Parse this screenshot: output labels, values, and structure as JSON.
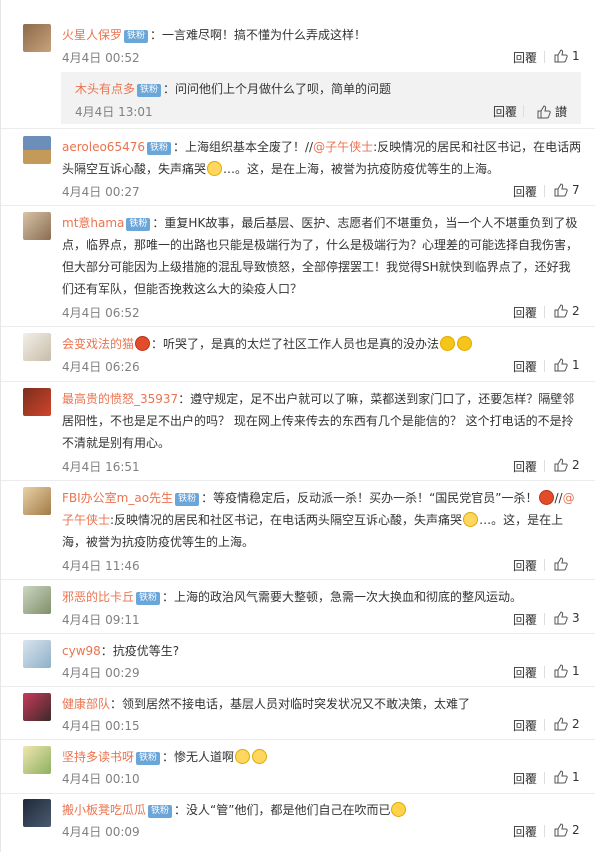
{
  "ui": {
    "reply_label": "回覆",
    "like_placeholder": "讃",
    "badge_label": "铁粉"
  },
  "comments": [
    {
      "user": "火星人保罗",
      "badge": true,
      "text": "：一言难尽啊！搞不懂为什么弄成这样！",
      "time": "4月4日 00:52",
      "likes": "1",
      "sub": {
        "user": "木头有点多",
        "badge": true,
        "text": "：问问他们上个月做什么了呗，简单的问题",
        "time": "4月4日 13:01"
      }
    },
    {
      "user": "aeroleo65476",
      "badge": true,
      "text_a": "：上海组织基本全废了！//",
      "mention": "@子午侠士",
      "text_b": ":反映情况的居民和社区书记，在电话两头隔空互诉心酸，失声痛哭",
      "text_c": "…。这，是在上海，被誉为抗疫防疫优等生的上海。",
      "time": "4月4日 00:27",
      "likes": "7"
    },
    {
      "user": "mt意hama",
      "badge": true,
      "text": "：重复HK故事，最后基层、医护、志愿者们不堪重负，当一个人不堪重负到了极点，临界点，那唯一的出路也只能是极端行为了，什么是极端行为？心理差的可能选择自我伤害，但大部分可能因为上级措施的混乱导致愤怒，全部停摆罢工！我觉得SH就快到临界点了，还好我们还有军队，但能否挽救这么大的染疫人口？",
      "time": "4月4日 06:52",
      "likes": "2"
    },
    {
      "user": "会变戏法的猫",
      "badge": false,
      "text": "：听哭了，是真的太烂了社区工作人员也是真的没办法",
      "time": "4月4日 06:26",
      "likes": "1"
    },
    {
      "user": "最高贵的愤怒_35937",
      "badge": false,
      "text": "：遵守规定，足不出户就可以了嘛，菜都送到家门口了，还要怎样？隔壁邻居阳性，不也是足不出户的吗？ 现在网上传来传去的东西有几个是能信的？ 这个打电话的不是拎不清就是别有用心。",
      "time": "4月4日 16:51",
      "likes": "2"
    },
    {
      "user": "FBI办公室m_ao先生",
      "badge": true,
      "text_a": "：等疫情稳定后，反动派一杀！买办一杀！“国民党官员”一杀！",
      "text_b": "//",
      "mention": "@子午侠士",
      "text_c": ":反映情况的居民和社区书记，在电话两头隔空互诉心酸，失声痛哭",
      "text_d": "…。这，是在上海，被誉为抗疫防疫优等生的上海。",
      "time": "4月4日 11:46",
      "likes": ""
    },
    {
      "user": "邪恶的比卡丘",
      "badge": true,
      "text": "：上海的政治风气需要大整顿，急需一次大换血和彻底的整风运动。",
      "time": "4月4日 09:11",
      "likes": "3"
    },
    {
      "user": "cyw98",
      "badge": false,
      "text": "：抗疫优等生?",
      "time": "4月4日 00:29",
      "likes": "1"
    },
    {
      "user": "健康部队",
      "badge": false,
      "text": "：领到居然不接电话，基层人员对临时突发状况又不敢决策，太难了",
      "time": "4月4日 00:15",
      "likes": "2"
    },
    {
      "user": "坚持多读书呀",
      "badge": true,
      "text": "：惨无人道啊",
      "time": "4月4日 00:10",
      "likes": "1"
    },
    {
      "user": "搬小板凳吃瓜瓜",
      "badge": true,
      "text": "：没人“管”他们，都是他们自己在吹而已",
      "time": "4月4日 00:09",
      "likes": "2"
    }
  ]
}
